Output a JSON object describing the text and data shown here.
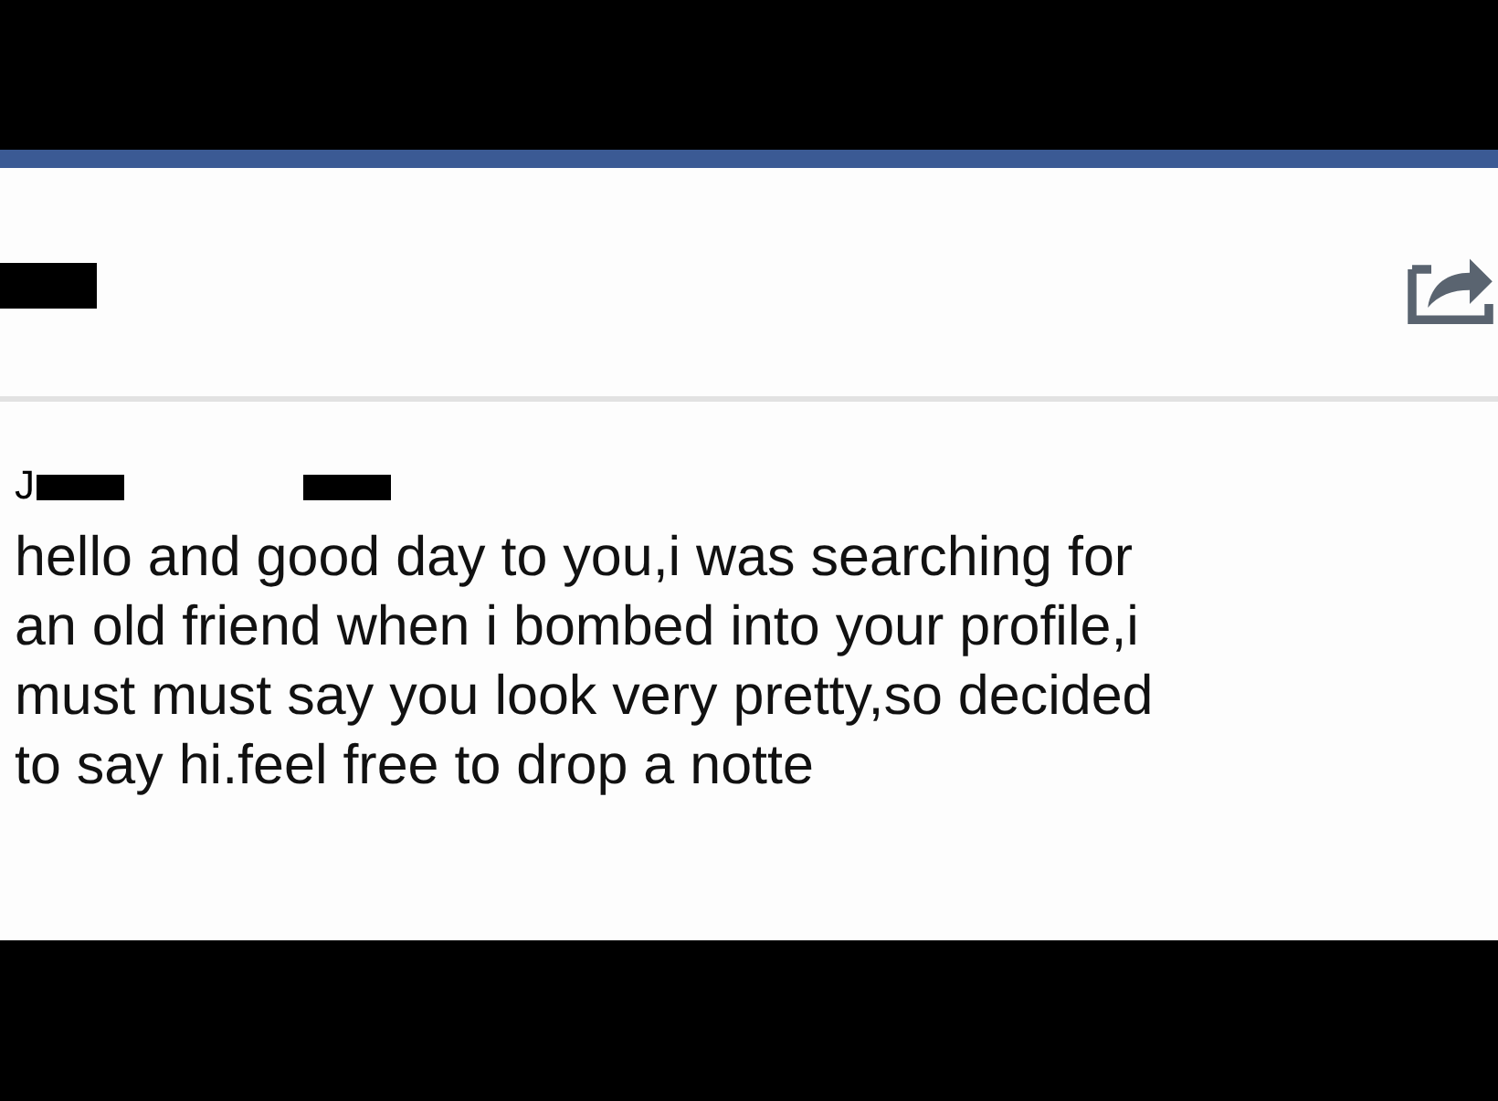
{
  "post": {
    "redacted": true
  },
  "message": {
    "sender_initial": "J",
    "sender_redacted": true,
    "lines": [
      "hello and good day to you,i was searching for",
      "an old friend when i bombed into your profile,i",
      "must must say you look very pretty,so decided",
      "to say hi.feel free to drop a notte"
    ]
  }
}
